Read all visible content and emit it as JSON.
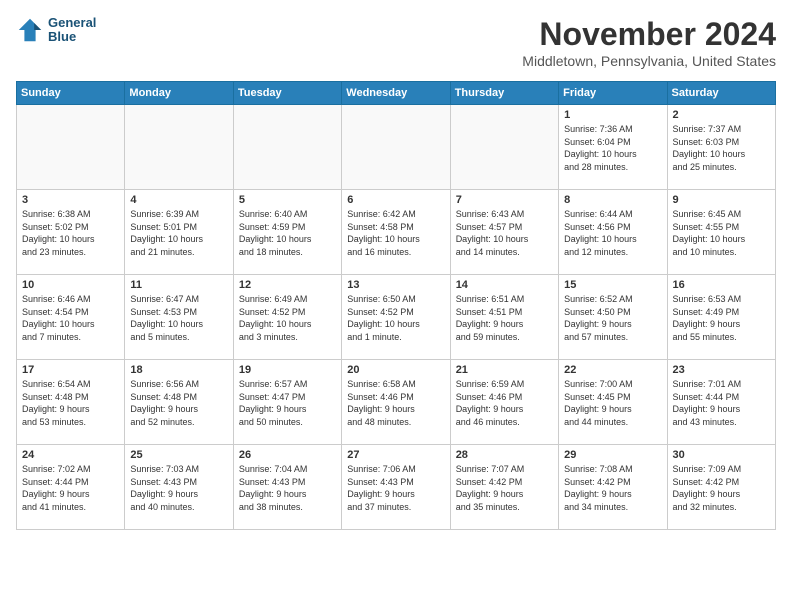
{
  "header": {
    "logo_line1": "General",
    "logo_line2": "Blue",
    "month": "November 2024",
    "location": "Middletown, Pennsylvania, United States"
  },
  "weekdays": [
    "Sunday",
    "Monday",
    "Tuesday",
    "Wednesday",
    "Thursday",
    "Friday",
    "Saturday"
  ],
  "weeks": [
    [
      {
        "day": "",
        "info": ""
      },
      {
        "day": "",
        "info": ""
      },
      {
        "day": "",
        "info": ""
      },
      {
        "day": "",
        "info": ""
      },
      {
        "day": "",
        "info": ""
      },
      {
        "day": "1",
        "info": "Sunrise: 7:36 AM\nSunset: 6:04 PM\nDaylight: 10 hours\nand 28 minutes."
      },
      {
        "day": "2",
        "info": "Sunrise: 7:37 AM\nSunset: 6:03 PM\nDaylight: 10 hours\nand 25 minutes."
      }
    ],
    [
      {
        "day": "3",
        "info": "Sunrise: 6:38 AM\nSunset: 5:02 PM\nDaylight: 10 hours\nand 23 minutes."
      },
      {
        "day": "4",
        "info": "Sunrise: 6:39 AM\nSunset: 5:01 PM\nDaylight: 10 hours\nand 21 minutes."
      },
      {
        "day": "5",
        "info": "Sunrise: 6:40 AM\nSunset: 4:59 PM\nDaylight: 10 hours\nand 18 minutes."
      },
      {
        "day": "6",
        "info": "Sunrise: 6:42 AM\nSunset: 4:58 PM\nDaylight: 10 hours\nand 16 minutes."
      },
      {
        "day": "7",
        "info": "Sunrise: 6:43 AM\nSunset: 4:57 PM\nDaylight: 10 hours\nand 14 minutes."
      },
      {
        "day": "8",
        "info": "Sunrise: 6:44 AM\nSunset: 4:56 PM\nDaylight: 10 hours\nand 12 minutes."
      },
      {
        "day": "9",
        "info": "Sunrise: 6:45 AM\nSunset: 4:55 PM\nDaylight: 10 hours\nand 10 minutes."
      }
    ],
    [
      {
        "day": "10",
        "info": "Sunrise: 6:46 AM\nSunset: 4:54 PM\nDaylight: 10 hours\nand 7 minutes."
      },
      {
        "day": "11",
        "info": "Sunrise: 6:47 AM\nSunset: 4:53 PM\nDaylight: 10 hours\nand 5 minutes."
      },
      {
        "day": "12",
        "info": "Sunrise: 6:49 AM\nSunset: 4:52 PM\nDaylight: 10 hours\nand 3 minutes."
      },
      {
        "day": "13",
        "info": "Sunrise: 6:50 AM\nSunset: 4:52 PM\nDaylight: 10 hours\nand 1 minute."
      },
      {
        "day": "14",
        "info": "Sunrise: 6:51 AM\nSunset: 4:51 PM\nDaylight: 9 hours\nand 59 minutes."
      },
      {
        "day": "15",
        "info": "Sunrise: 6:52 AM\nSunset: 4:50 PM\nDaylight: 9 hours\nand 57 minutes."
      },
      {
        "day": "16",
        "info": "Sunrise: 6:53 AM\nSunset: 4:49 PM\nDaylight: 9 hours\nand 55 minutes."
      }
    ],
    [
      {
        "day": "17",
        "info": "Sunrise: 6:54 AM\nSunset: 4:48 PM\nDaylight: 9 hours\nand 53 minutes."
      },
      {
        "day": "18",
        "info": "Sunrise: 6:56 AM\nSunset: 4:48 PM\nDaylight: 9 hours\nand 52 minutes."
      },
      {
        "day": "19",
        "info": "Sunrise: 6:57 AM\nSunset: 4:47 PM\nDaylight: 9 hours\nand 50 minutes."
      },
      {
        "day": "20",
        "info": "Sunrise: 6:58 AM\nSunset: 4:46 PM\nDaylight: 9 hours\nand 48 minutes."
      },
      {
        "day": "21",
        "info": "Sunrise: 6:59 AM\nSunset: 4:46 PM\nDaylight: 9 hours\nand 46 minutes."
      },
      {
        "day": "22",
        "info": "Sunrise: 7:00 AM\nSunset: 4:45 PM\nDaylight: 9 hours\nand 44 minutes."
      },
      {
        "day": "23",
        "info": "Sunrise: 7:01 AM\nSunset: 4:44 PM\nDaylight: 9 hours\nand 43 minutes."
      }
    ],
    [
      {
        "day": "24",
        "info": "Sunrise: 7:02 AM\nSunset: 4:44 PM\nDaylight: 9 hours\nand 41 minutes."
      },
      {
        "day": "25",
        "info": "Sunrise: 7:03 AM\nSunset: 4:43 PM\nDaylight: 9 hours\nand 40 minutes."
      },
      {
        "day": "26",
        "info": "Sunrise: 7:04 AM\nSunset: 4:43 PM\nDaylight: 9 hours\nand 38 minutes."
      },
      {
        "day": "27",
        "info": "Sunrise: 7:06 AM\nSunset: 4:43 PM\nDaylight: 9 hours\nand 37 minutes."
      },
      {
        "day": "28",
        "info": "Sunrise: 7:07 AM\nSunset: 4:42 PM\nDaylight: 9 hours\nand 35 minutes."
      },
      {
        "day": "29",
        "info": "Sunrise: 7:08 AM\nSunset: 4:42 PM\nDaylight: 9 hours\nand 34 minutes."
      },
      {
        "day": "30",
        "info": "Sunrise: 7:09 AM\nSunset: 4:42 PM\nDaylight: 9 hours\nand 32 minutes."
      }
    ]
  ]
}
